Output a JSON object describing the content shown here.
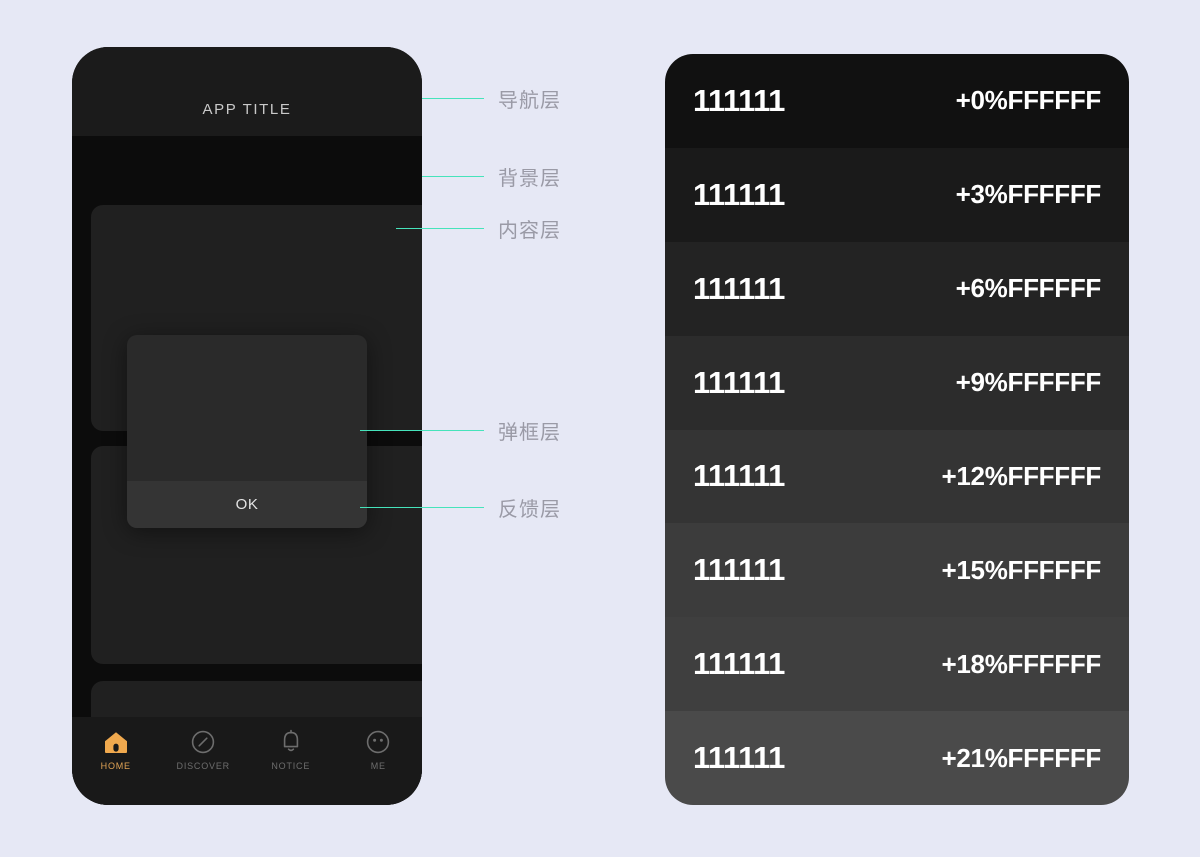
{
  "page": {
    "background_color": "#e6e8f5",
    "accent_color": "#46e3bb",
    "active_tab_color": "#e0a355"
  },
  "phone": {
    "nav": {
      "title": "APP TITLE"
    },
    "modal": {
      "ok_label": "OK"
    },
    "tabbar": {
      "items": [
        {
          "label": "HOME",
          "icon": "home-icon",
          "active": true
        },
        {
          "label": "DISCOVER",
          "icon": "compass-icon",
          "active": false
        },
        {
          "label": "NOTICE",
          "icon": "bell-icon",
          "active": false
        },
        {
          "label": "ME",
          "icon": "face-icon",
          "active": false
        }
      ]
    }
  },
  "annotations": [
    {
      "label": "导航层"
    },
    {
      "label": "背景层"
    },
    {
      "label": "内容层"
    },
    {
      "label": "弹框层"
    },
    {
      "label": "反馈层"
    }
  ],
  "panel": {
    "rows": [
      {
        "left": "111111",
        "right": "+0%FFFFFF",
        "bg": "#111111"
      },
      {
        "left": "111111",
        "right": "+3%FFFFFF",
        "bg": "#1a1a1a"
      },
      {
        "left": "111111",
        "right": "+6%FFFFFF",
        "bg": "#232323"
      },
      {
        "left": "111111",
        "right": "+9%FFFFFF",
        "bg": "#2c2c2c"
      },
      {
        "left": "111111",
        "right": "+12%FFFFFF",
        "bg": "#343434"
      },
      {
        "left": "111111",
        "right": "+15%FFFFFF",
        "bg": "#3c3c3c"
      },
      {
        "left": "111111",
        "right": "+18%FFFFFF",
        "bg": "#3f3f3f"
      },
      {
        "left": "111111",
        "right": "+21%FFFFFF",
        "bg": "#4a4a4a"
      }
    ]
  }
}
